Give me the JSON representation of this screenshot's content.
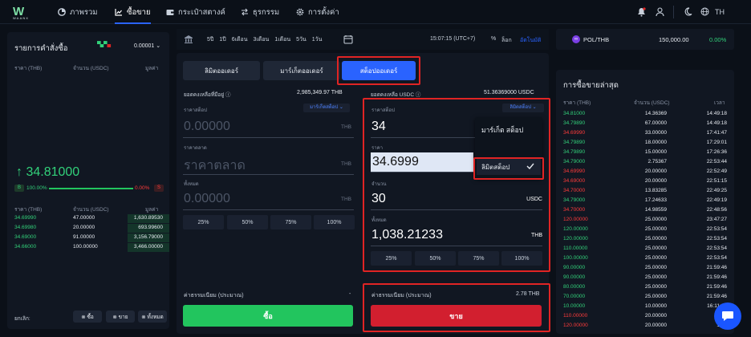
{
  "nav": {
    "overview": "ภาพรวม",
    "trade": "ซื้อขาย",
    "wallet": "กระเป๋าสตางค์",
    "transactions": "ธุรกรรม",
    "settings": "การตั้งค่า",
    "lang": "TH"
  },
  "logo": {
    "letter": "W",
    "word": "WAANX"
  },
  "orderbook": {
    "title": "รายการคำสั่งซื้อ",
    "precision": "0.00001",
    "col_price": "ราคา (THB)",
    "col_amount": "จำนวน (USDC)",
    "col_value": "มูลค่า",
    "last_price": "↑ 34.81000",
    "buy_pct": "100.00%",
    "sell_pct": "0.00%",
    "buy_label": "B",
    "sell_label": "S",
    "rows": [
      {
        "price": "34.69990",
        "amount": "47.00000",
        "value": "1,630.89530"
      },
      {
        "price": "34.69980",
        "amount": "20.00000",
        "value": "693.99600"
      },
      {
        "price": "34.69000",
        "amount": "91.00000",
        "value": "3,156.79000"
      },
      {
        "price": "34.66000",
        "amount": "100.00000",
        "value": "3,466.00000"
      }
    ],
    "cancel_label": "ยกเลิก:",
    "cancel_buy": "ซื้อ",
    "cancel_sell": "ขาย",
    "cancel_all": "ทั้งหมด"
  },
  "chartbar": {
    "ranges": [
      "5ปี",
      "1ปี",
      "6เดือน",
      "3เดือน",
      "1เดือน",
      "5วัน",
      "1วัน"
    ],
    "time": "15:07:15 (UTC+7)",
    "pct": "%",
    "log": "ล็อก",
    "auto": "อัตโนมัติ"
  },
  "order_tabs": {
    "limit": "ลิมิตออเดอร์",
    "market": "มาร์เก็ตออเดอร์",
    "stop": "สต็อปออเดอร์"
  },
  "buy_form": {
    "balance_label": "ยอดคงเหลือที่มีอยู่",
    "balance": "2,985,349.97 THB",
    "stop_price_label": "ราคาสต็อป",
    "type_select": "มาร์เก็ตสต็อป",
    "stop_value": "0.00000",
    "currency": "THB",
    "price_label": "ราคาตลาด",
    "price_placeholder": "ราคาตลาด",
    "total_label": "ทั้งหมด",
    "total_value": "0.00000",
    "fee_label": "ค่าธรรมเนียม (ประมาณ)",
    "fee_value": "-",
    "submit": "ซื้อ"
  },
  "sell_form": {
    "balance_label": "ยอดคงเหลือ USDC",
    "balance": "51.36369000 USDC",
    "stop_price_label": "ราคาสต็อป",
    "type_select": "ลิมิตสต็อป",
    "stop_value": "34",
    "price_label": "ราคา",
    "price_value": "34.6999",
    "amount_label": "จำนวน",
    "amount_value": "30",
    "amount_unit": "USDC",
    "total_label": "ทั้งหมด",
    "total_value": "1,038.21233",
    "total_unit": "THB",
    "fee_label": "ค่าธรรมเนียม (ประมาณ)",
    "fee_value": "2.78 THB",
    "submit": "ขาย"
  },
  "percents": [
    "25%",
    "50%",
    "75%",
    "100%"
  ],
  "dropdown": {
    "option1": "มาร์เก็ต สต็อป",
    "option2": "ลิมิตสต็อป"
  },
  "ticker": {
    "symbol": "POL/THB",
    "price": "150,000.00",
    "change": "0.00%"
  },
  "recent": {
    "title": "การซื้อขายล่าสุด",
    "col_price": "ราคา (THB)",
    "col_amount": "จำนวน (USDC)",
    "col_time": "เวลา",
    "rows": [
      {
        "p": "34.81000",
        "a": "14.36369",
        "t": "14:49:18",
        "s": "g"
      },
      {
        "p": "34.79890",
        "a": "67.00000",
        "t": "14:49:18",
        "s": "g"
      },
      {
        "p": "34.69990",
        "a": "33.00000",
        "t": "17:41:47",
        "s": "r"
      },
      {
        "p": "34.79890",
        "a": "18.00000",
        "t": "17:29:01",
        "s": "g"
      },
      {
        "p": "34.79890",
        "a": "15.00000",
        "t": "17:26:36",
        "s": "g"
      },
      {
        "p": "34.79000",
        "a": "2.75367",
        "t": "22:53:44",
        "s": "g"
      },
      {
        "p": "34.69990",
        "a": "20.00000",
        "t": "22:52:49",
        "s": "r"
      },
      {
        "p": "34.69000",
        "a": "20.00000",
        "t": "22:51:15",
        "s": "r"
      },
      {
        "p": "34.70000",
        "a": "13.83285",
        "t": "22:49:25",
        "s": "r"
      },
      {
        "p": "34.79000",
        "a": "17.24633",
        "t": "22:49:19",
        "s": "g"
      },
      {
        "p": "34.70000",
        "a": "14.98559",
        "t": "22:48:56",
        "s": "r"
      },
      {
        "p": "120.00000",
        "a": "25.00000",
        "t": "23:47:27",
        "s": "r"
      },
      {
        "p": "120.00000",
        "a": "25.00000",
        "t": "22:53:54",
        "s": "g"
      },
      {
        "p": "120.00000",
        "a": "25.00000",
        "t": "22:53:54",
        "s": "g"
      },
      {
        "p": "110.00000",
        "a": "25.00000",
        "t": "22:53:54",
        "s": "g"
      },
      {
        "p": "100.00000",
        "a": "25.00000",
        "t": "22:53:54",
        "s": "g"
      },
      {
        "p": "90.00000",
        "a": "25.00000",
        "t": "21:59:46",
        "s": "g"
      },
      {
        "p": "90.00000",
        "a": "25.00000",
        "t": "21:59:46",
        "s": "g"
      },
      {
        "p": "80.00000",
        "a": "25.00000",
        "t": "21:59:46",
        "s": "g"
      },
      {
        "p": "70.00000",
        "a": "25.00000",
        "t": "21:59:46",
        "s": "g"
      },
      {
        "p": "10.00000",
        "a": "10.00000",
        "t": "16:11:39",
        "s": "g"
      },
      {
        "p": "110.00000",
        "a": "20.00000",
        "t": "15:4",
        "s": "r"
      },
      {
        "p": "120.00000",
        "a": "20.00000",
        "t": "15:4",
        "s": "r"
      }
    ]
  },
  "colors": {
    "accent": "#2a63ff",
    "buy": "#22c55e",
    "sell": "#d21f2f",
    "highlight": "#e02424"
  }
}
